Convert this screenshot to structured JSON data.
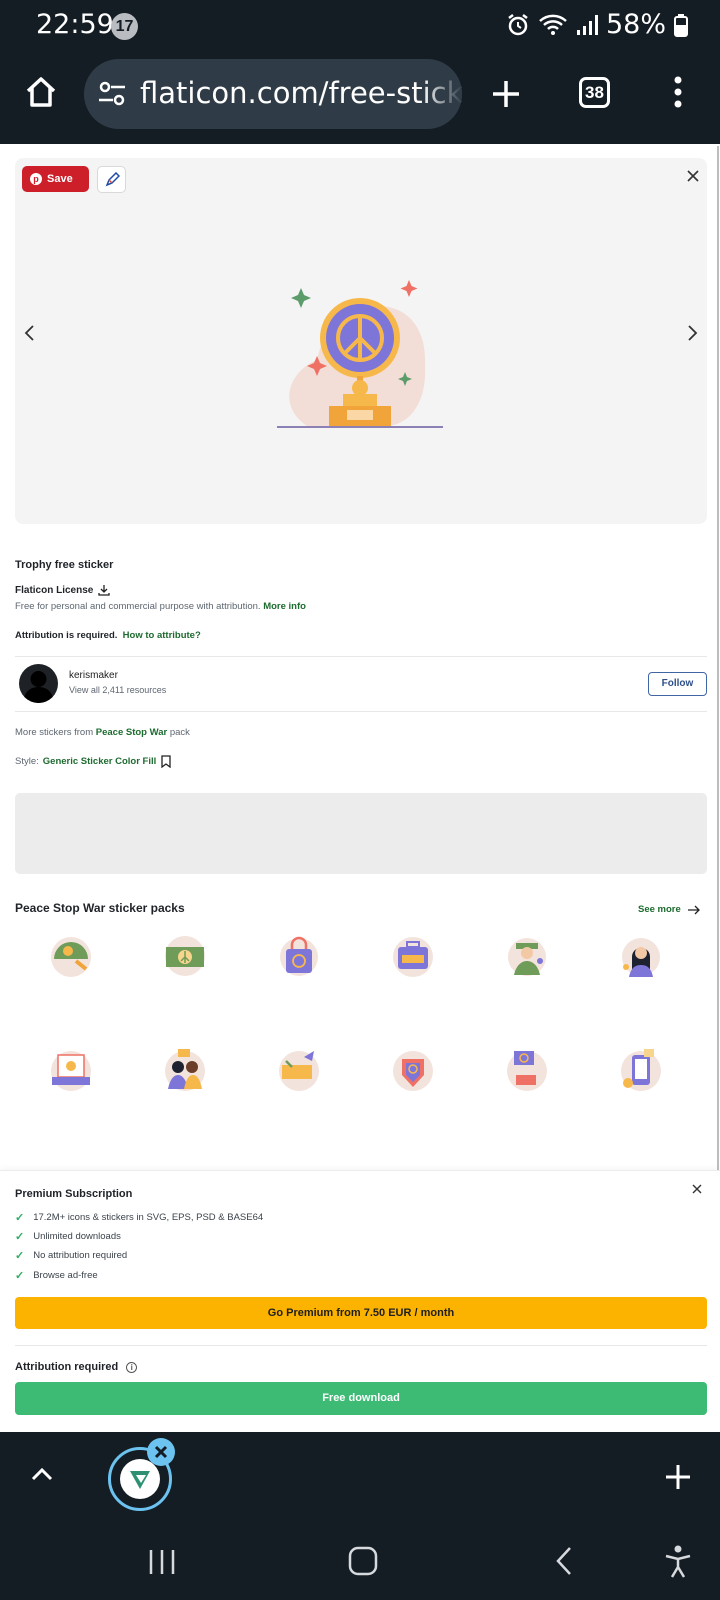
{
  "status": {
    "time": "22:59",
    "notif_count": "17",
    "battery": "58%"
  },
  "browser": {
    "url": "flaticon.com/free-sticker",
    "tab_count": "38"
  },
  "preview": {
    "pin_label": "Save"
  },
  "detail": {
    "title": "Trophy free sticker",
    "license": "Flaticon License",
    "license_desc": "Free for personal and commercial purpose with attribution.",
    "more_info": "More info",
    "attr_required": "Attribution is required.",
    "how_to_attr": "How to attribute?"
  },
  "author": {
    "name": "kerismaker",
    "resources": "View all 2,411 resources",
    "follow_label": "Follow"
  },
  "more": {
    "prefix": "More stickers from",
    "pack_name": "Peace Stop War",
    "suffix": "pack"
  },
  "style": {
    "prefix": "Style:",
    "name": "Generic Sticker Color Fill"
  },
  "packs": {
    "title": "Peace Stop War sticker packs",
    "see_more": "See more"
  },
  "stickers": [
    "helmet-sticker",
    "banknote-sticker",
    "shopping-bag-sticker",
    "briefcase-sticker",
    "soldier-sticker",
    "woman-sticker",
    "laptop-sticker",
    "couple-sticker",
    "dove-sticker",
    "heart-hand-sticker",
    "sign-sticker",
    "phone-sticker"
  ],
  "premium": {
    "title": "Premium Subscription",
    "features": [
      "17.2M+ icons & stickers in SVG, EPS, PSD & BASE64",
      "Unlimited downloads",
      "No attribution required",
      "Browse ad-free"
    ],
    "button": "Go Premium from 7.50 EUR / month"
  },
  "download": {
    "attr_label": "Attribution required",
    "button": "Free download"
  },
  "colors": {
    "accent_green": "#1d6b2f",
    "pinterest_red": "#cc1f29",
    "premium_yellow": "#fbb300",
    "download_green": "#3dbb75",
    "system_bar": "#141c24"
  }
}
